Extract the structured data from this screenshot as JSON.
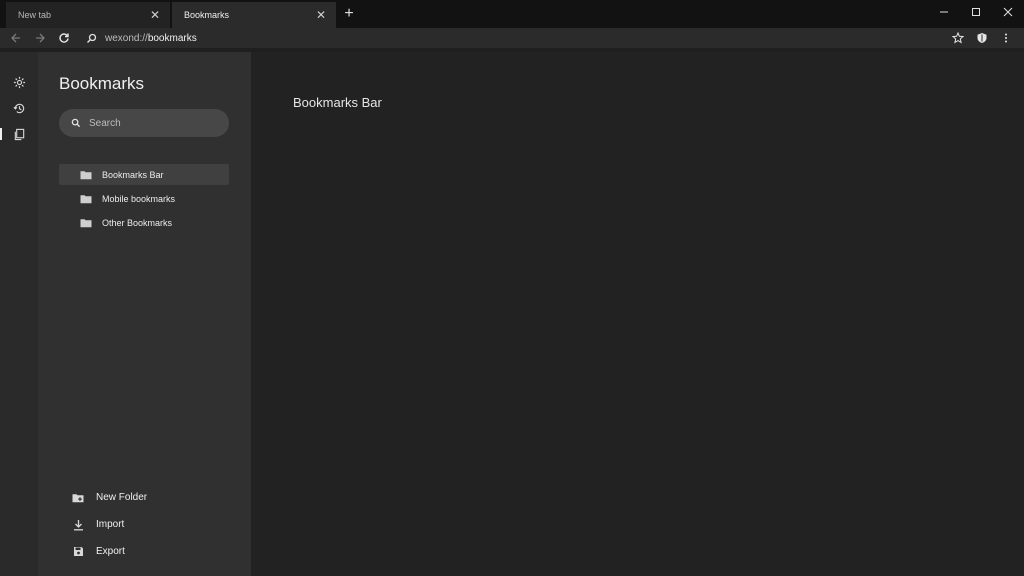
{
  "tabs": [
    {
      "label": "New tab",
      "active": false
    },
    {
      "label": "Bookmarks",
      "active": true
    }
  ],
  "window_controls": {
    "minimize": "–",
    "maximize": "☐",
    "close": "✕"
  },
  "toolbar": {
    "url_prefix": "wexond://",
    "url_host": "bookmarks",
    "icons": [
      "back-arrow-icon",
      "forward-arrow-icon",
      "reload-icon",
      "search-icon",
      "star-icon",
      "shield-icon",
      "more-vert-icon"
    ]
  },
  "rail": {
    "items": [
      "settings-icon",
      "history-icon",
      "bookmarks-icon"
    ],
    "active": "bookmarks-icon"
  },
  "panel": {
    "title": "Bookmarks",
    "search": {
      "placeholder": "Search",
      "value": ""
    },
    "folders": [
      {
        "label": "Bookmarks Bar",
        "selected": true
      },
      {
        "label": "Mobile bookmarks",
        "selected": false
      },
      {
        "label": "Other Bookmarks",
        "selected": false
      }
    ],
    "actions": [
      {
        "label": "New Folder",
        "icon": "new-folder-icon"
      },
      {
        "label": "Import",
        "icon": "import-icon"
      },
      {
        "label": "Export",
        "icon": "export-icon"
      }
    ]
  },
  "main": {
    "title": "Bookmarks Bar"
  },
  "colors": {
    "background": "#222222",
    "panel": "#303030",
    "rail": "#2a2a2a",
    "selected": "#404040",
    "titlebar": "#121212"
  }
}
